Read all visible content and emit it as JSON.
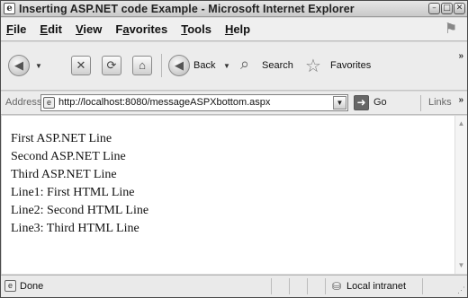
{
  "window": {
    "title": "Inserting ASP.NET code Example - Microsoft Internet Explorer",
    "controls": {
      "minimize": "–",
      "maximize": "□",
      "close": "✕"
    }
  },
  "menu": {
    "items": [
      {
        "key": "F",
        "rest": "ile"
      },
      {
        "key": "E",
        "rest": "dit"
      },
      {
        "key": "V",
        "rest": "iew"
      },
      {
        "pre": "F",
        "key": "a",
        "rest": "vorites"
      },
      {
        "key": "T",
        "rest": "ools"
      },
      {
        "key": "H",
        "rest": "elp"
      }
    ]
  },
  "toolbar": {
    "back_label": "Back",
    "search_label": "Search",
    "favorites_label": "Favorites",
    "icons": [
      "back-arrow-icon",
      "forward-arrow-icon",
      "stop-icon",
      "refresh-icon",
      "home-icon",
      "search-icon",
      "favorites-star-icon"
    ]
  },
  "address": {
    "label": "Address",
    "url": "http://localhost:8080/messageASPXbottom.aspx",
    "go_label": "Go",
    "links_label": "Links"
  },
  "content": {
    "lines": [
      "First ASP.NET Line",
      "Second ASP.NET Line",
      "Third ASP.NET Line",
      "Line1: First HTML Line",
      "Line2: Second HTML Line",
      "Line3: Third HTML Line"
    ]
  },
  "status": {
    "text": "Done",
    "zone": "Local intranet"
  }
}
